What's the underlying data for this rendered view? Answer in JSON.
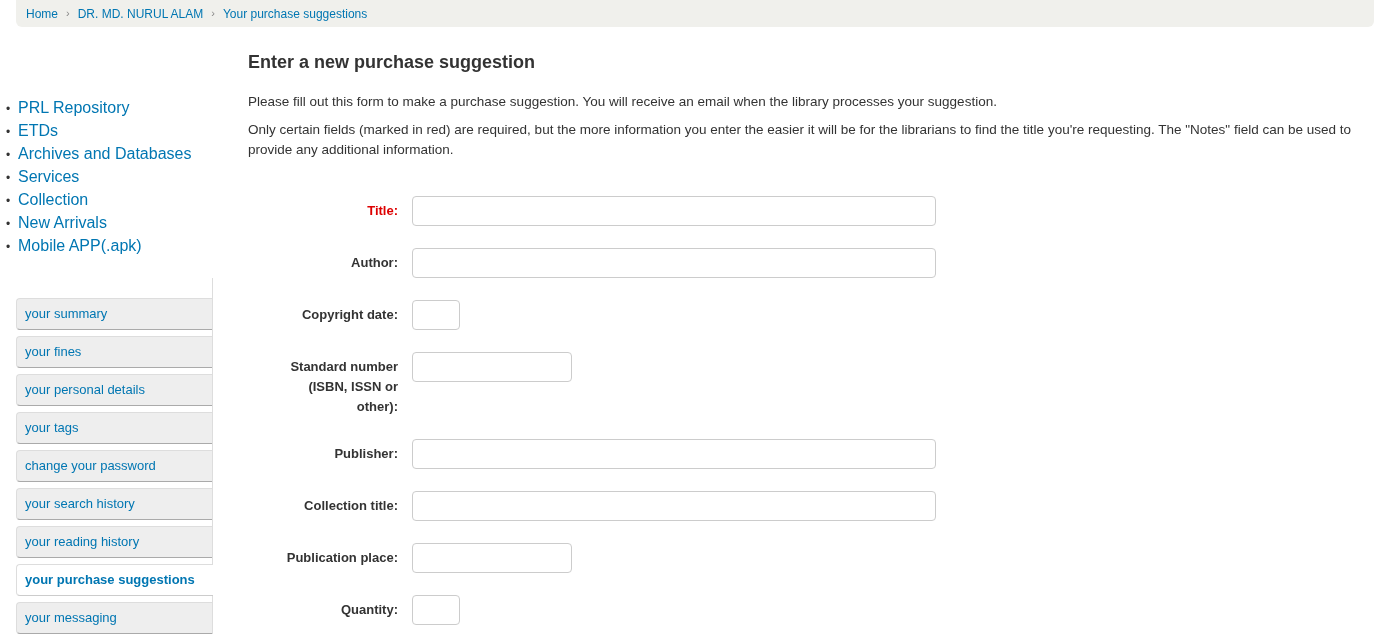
{
  "breadcrumb": [
    {
      "label": "Home"
    },
    {
      "separator": "›",
      "label": "DR. MD. NURUL ALAM"
    },
    {
      "separator": "›",
      "label": "Your purchase suggestions"
    }
  ],
  "links": [
    {
      "bullet": "•",
      "label": "PRL Repository"
    },
    {
      "bullet": "•",
      "label": "ETDs"
    },
    {
      "bullet": "•",
      "label": "Archives and Databases"
    },
    {
      "bullet": "•",
      "label": "Services"
    },
    {
      "bullet": "•",
      "label": "Collection"
    },
    {
      "bullet": "•",
      "label": "New Arrivals"
    },
    {
      "bullet": "•",
      "label": "Mobile APP(.apk)"
    }
  ],
  "user_menu": [
    {
      "label": "your summary",
      "selected": false
    },
    {
      "label": "your fines",
      "selected": false
    },
    {
      "label": "your personal details",
      "selected": false
    },
    {
      "label": "your tags",
      "selected": false
    },
    {
      "label": "change your password",
      "selected": false
    },
    {
      "label": "your search history",
      "selected": false
    },
    {
      "label": "your reading history",
      "selected": false
    },
    {
      "label": "your purchase suggestions",
      "selected": true
    },
    {
      "label": "your messaging",
      "selected": false
    }
  ],
  "heading": "Enter a new purchase suggestion",
  "intro": [
    "Please fill out this form to make a purchase suggestion. You will receive an email when the library processes your suggestion.",
    "Only certain fields (marked in red) are required, but the more information you enter the easier it will be for the librarians to find the title you're requesting. The \"Notes\" field can be used to provide any additional information."
  ],
  "fields": [
    {
      "label": "Title:",
      "required": true,
      "kind": "wide"
    },
    {
      "label": "Author:",
      "required": false,
      "kind": "wide"
    },
    {
      "label": "Copyright date:",
      "required": false,
      "kind": "small"
    },
    {
      "label": "Standard number (ISBN, ISSN or other):",
      "required": false,
      "kind": "medium"
    },
    {
      "label": "Publisher:",
      "required": false,
      "kind": "wide"
    },
    {
      "label": "Collection title:",
      "required": false,
      "kind": "wide"
    },
    {
      "label": "Publication place:",
      "required": false,
      "kind": "medium"
    },
    {
      "label": "Quantity:",
      "required": false,
      "kind": "small"
    }
  ]
}
